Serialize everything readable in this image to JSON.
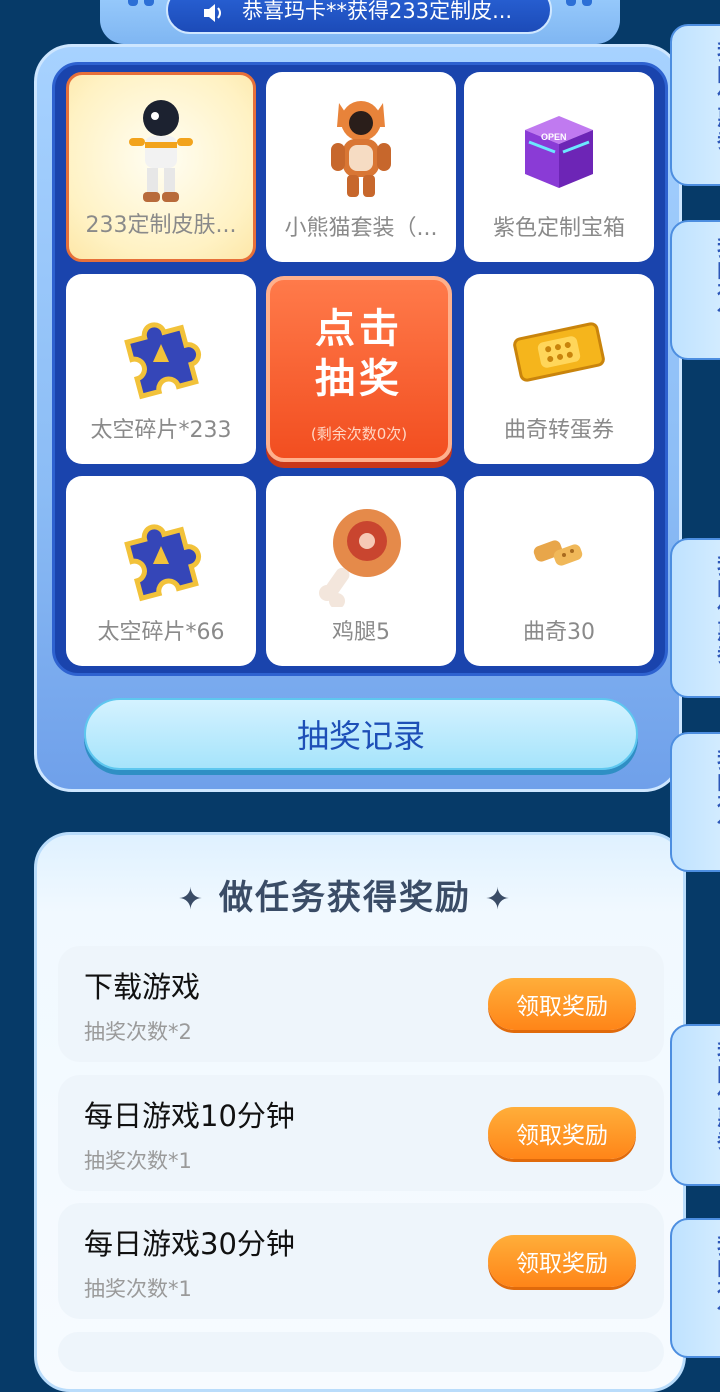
{
  "announcement": {
    "icon": "speaker-icon",
    "text": "恭喜玛卡**获得233定制皮..."
  },
  "prizes": [
    {
      "label": "233定制皮肤...",
      "icon": "astronaut-skin-icon",
      "selected": true
    },
    {
      "label": "小熊猫套装（...",
      "icon": "red-panda-costume-icon"
    },
    {
      "label": "紫色定制宝箱",
      "icon": "purple-chest-icon",
      "chest_text": "OPEN"
    },
    {
      "label": "太空碎片*233",
      "icon": "puzzle-piece-icon"
    },
    {
      "label": "曲奇转蛋券",
      "icon": "gold-ticket-icon"
    },
    {
      "label": "太空碎片*66",
      "icon": "puzzle-piece-icon"
    },
    {
      "label": "鸡腿5",
      "icon": "drumstick-icon"
    },
    {
      "label": "曲奇30",
      "icon": "cookie-icon"
    }
  ],
  "draw": {
    "line1": "点击",
    "line2": "抽奖",
    "remaining": "(剩余次数0次)"
  },
  "record_button": "抽奖记录",
  "tasks": {
    "title": "做任务获得奖励",
    "items": [
      {
        "name": "下载游戏",
        "reward": "抽奖次数*2",
        "button": "领取奖励"
      },
      {
        "name": "每日游戏10分钟",
        "reward": "抽奖次数*1",
        "button": "领取奖励"
      },
      {
        "name": "每日游戏30分钟",
        "reward": "抽奖次数*1",
        "button": "领取奖励"
      }
    ]
  },
  "side_tabs": {
    "coupons": "我的优惠券",
    "gifts": "我的礼包"
  },
  "colors": {
    "background": "#063a68",
    "accent_orange": "#ff8518",
    "board_blue": "#1a44ad"
  }
}
